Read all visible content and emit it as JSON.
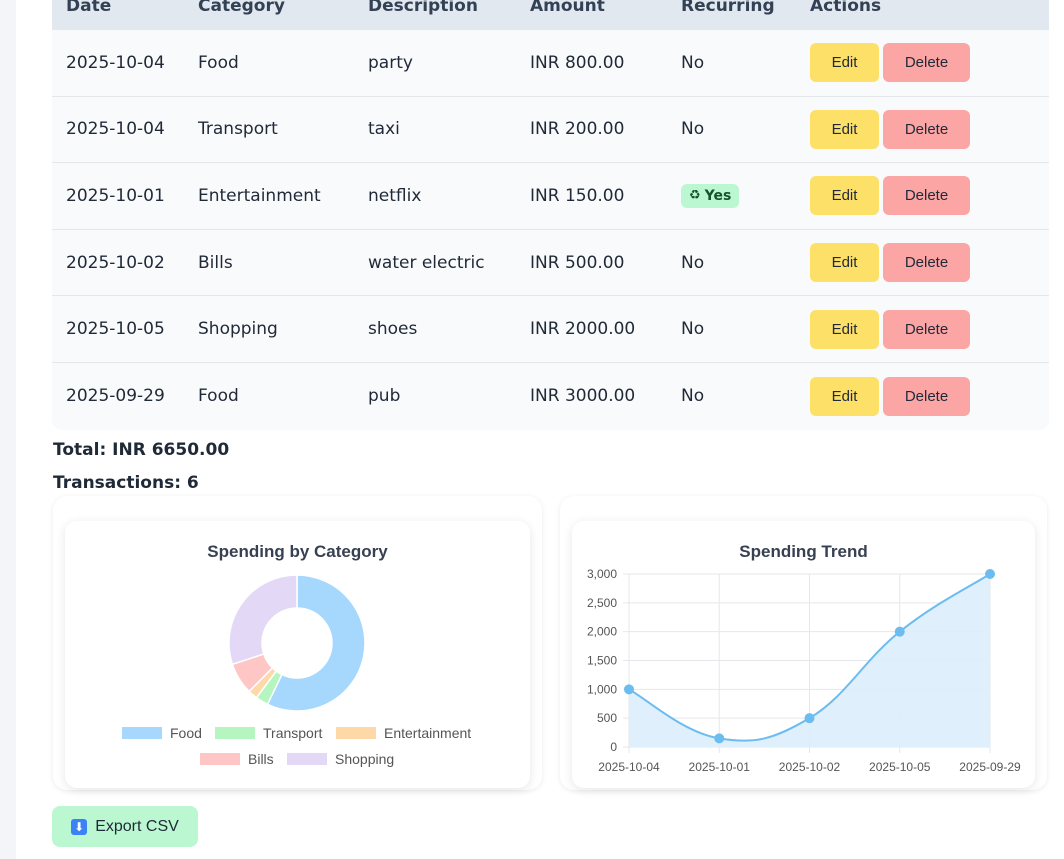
{
  "table": {
    "headers": [
      "Date",
      "Category",
      "Description",
      "Amount",
      "Recurring",
      "Actions"
    ],
    "rows": [
      {
        "date": "2025-10-04",
        "category": "Food",
        "description": "party",
        "amount": "INR 800.00",
        "recurring": "No"
      },
      {
        "date": "2025-10-04",
        "category": "Transport",
        "description": "taxi",
        "amount": "INR 200.00",
        "recurring": "No"
      },
      {
        "date": "2025-10-01",
        "category": "Entertainment",
        "description": "netflix",
        "amount": "INR 150.00",
        "recurring": "Yes"
      },
      {
        "date": "2025-10-02",
        "category": "Bills",
        "description": "water electric",
        "amount": "INR 500.00",
        "recurring": "No"
      },
      {
        "date": "2025-10-05",
        "category": "Shopping",
        "description": "shoes",
        "amount": "INR 2000.00",
        "recurring": "No"
      },
      {
        "date": "2025-09-29",
        "category": "Food",
        "description": "pub",
        "amount": "INR 3000.00",
        "recurring": "No"
      }
    ],
    "edit_label": "Edit",
    "delete_label": "Delete"
  },
  "summary": {
    "total": "Total: INR 6650.00",
    "transactions": "Transactions: 6"
  },
  "chart_data": [
    {
      "type": "pie",
      "title": "Spending by Category",
      "categories": [
        "Food",
        "Transport",
        "Entertainment",
        "Bills",
        "Shopping"
      ],
      "values": [
        3800,
        200,
        150,
        500,
        2000
      ],
      "colors": [
        "#a5d8fc",
        "#b5f5c0",
        "#ffd8a8",
        "#ffc6c6",
        "#e3d8f5"
      ],
      "legend": "bottom"
    },
    {
      "type": "area",
      "title": "Spending Trend",
      "categories": [
        "2025-10-04",
        "2025-10-01",
        "2025-10-02",
        "2025-10-05",
        "2025-09-29"
      ],
      "values": [
        1000,
        150,
        500,
        2000,
        3000
      ],
      "ylim": [
        0,
        3000
      ],
      "yticks": [
        "0",
        "500",
        "1,000",
        "1,500",
        "2,000",
        "2,500",
        "3,000"
      ],
      "grid": true,
      "colors": {
        "line": "#6cbcf0",
        "fill": "#dbeefc",
        "point": "#6cbcf0"
      }
    }
  ],
  "export": {
    "label": "Export CSV"
  }
}
